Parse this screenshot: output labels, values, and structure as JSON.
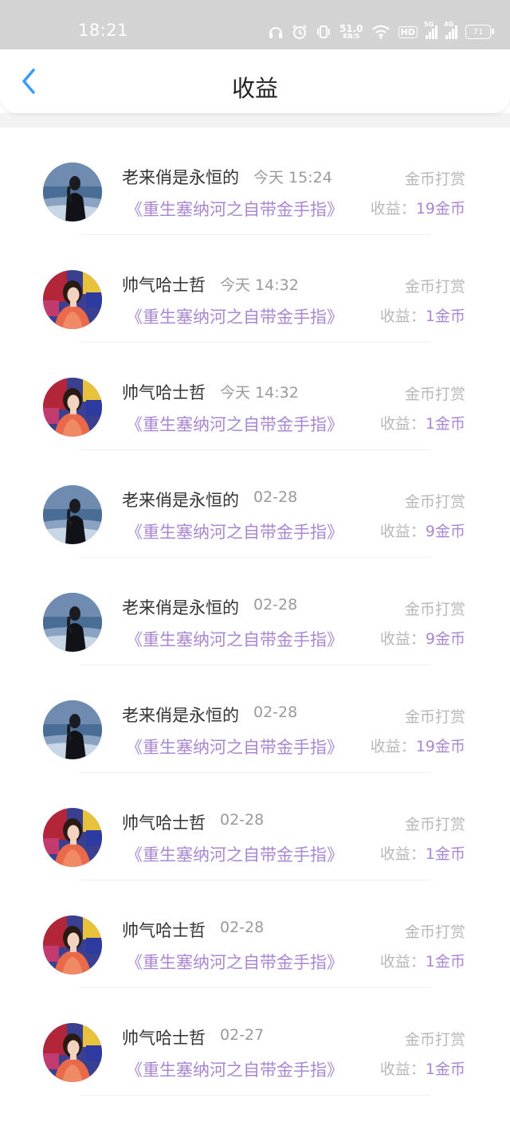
{
  "status_bar": {
    "time": "18:21",
    "net_speed_value": "51.0",
    "net_speed_unit": "KB/S",
    "hd_label": "HD",
    "signal_1_label": "5G",
    "signal_2_label": "4G",
    "battery": "71",
    "icons": [
      "headphones-icon",
      "alarm-icon",
      "vibrate-icon",
      "wifi-icon",
      "hd-icon",
      "signal-icon",
      "signal-icon",
      "battery-icon"
    ]
  },
  "header": {
    "title": "收益",
    "back_icon": "chevron-left-icon"
  },
  "colors": {
    "accent": "#3a9cf3",
    "book_purple": "#a987d2",
    "status_bar": "#d3d3d3"
  },
  "income_label": "收益：",
  "records": [
    {
      "user": "老来俏是永恒的",
      "time": "今天 15:24",
      "type": "金币打赏",
      "book": "《重生塞纳河之自带金手指》",
      "income": "19金币",
      "avatar": "sea-woman"
    },
    {
      "user": "帅气哈士哲",
      "time": "今天 14:32",
      "type": "金币打赏",
      "book": "《重生塞纳河之自带金手指》",
      "income": "1金币",
      "avatar": "girl-red"
    },
    {
      "user": "帅气哈士哲",
      "time": "今天 14:32",
      "type": "金币打赏",
      "book": "《重生塞纳河之自带金手指》",
      "income": "1金币",
      "avatar": "girl-red"
    },
    {
      "user": "老来俏是永恒的",
      "time": "02-28",
      "type": "金币打赏",
      "book": "《重生塞纳河之自带金手指》",
      "income": "9金币",
      "avatar": "sea-woman"
    },
    {
      "user": "老来俏是永恒的",
      "time": "02-28",
      "type": "金币打赏",
      "book": "《重生塞纳河之自带金手指》",
      "income": "9金币",
      "avatar": "sea-woman"
    },
    {
      "user": "老来俏是永恒的",
      "time": "02-28",
      "type": "金币打赏",
      "book": "《重生塞纳河之自带金手指》",
      "income": "19金币",
      "avatar": "sea-woman"
    },
    {
      "user": "帅气哈士哲",
      "time": "02-28",
      "type": "金币打赏",
      "book": "《重生塞纳河之自带金手指》",
      "income": "1金币",
      "avatar": "girl-red"
    },
    {
      "user": "帅气哈士哲",
      "time": "02-28",
      "type": "金币打赏",
      "book": "《重生塞纳河之自带金手指》",
      "income": "1金币",
      "avatar": "girl-red"
    },
    {
      "user": "帅气哈士哲",
      "time": "02-27",
      "type": "金币打赏",
      "book": "《重生塞纳河之自带金手指》",
      "income": "1金币",
      "avatar": "girl-red"
    }
  ]
}
